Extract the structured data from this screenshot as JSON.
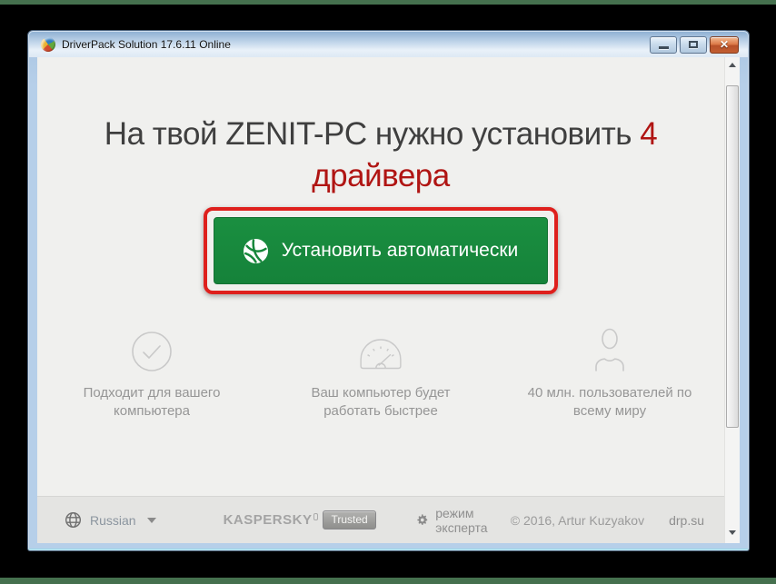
{
  "window": {
    "title": "DriverPack Solution 17.6.11 Online"
  },
  "main": {
    "heading": {
      "prefix": "На твой ZENIT-PC нужно установить",
      "count": "4",
      "suffix": "драйвера"
    },
    "install_button": {
      "label": "Установить автоматически"
    },
    "features": [
      {
        "icon": "check-circle-icon",
        "label": "Подходит для вашего компьютера"
      },
      {
        "icon": "speedometer-icon",
        "label": "Ваш компьютер будет работать быстрее"
      },
      {
        "icon": "user-icon",
        "label": "40 млн. пользователей по всему миру"
      }
    ]
  },
  "footer": {
    "language_label": "Russian",
    "kaspersky_brand": "KASPERSKY",
    "kaspersky_badge": "Trusted",
    "expert_mode_label": "режим эксперта",
    "copyright": "© 2016, Artur Kuzyakov",
    "site": "drp.su"
  },
  "colors": {
    "accent_green": "#17873b",
    "annotation_red": "#de201d",
    "heading_red": "#b01513",
    "titlebar_blue": "#b6cfe9"
  }
}
